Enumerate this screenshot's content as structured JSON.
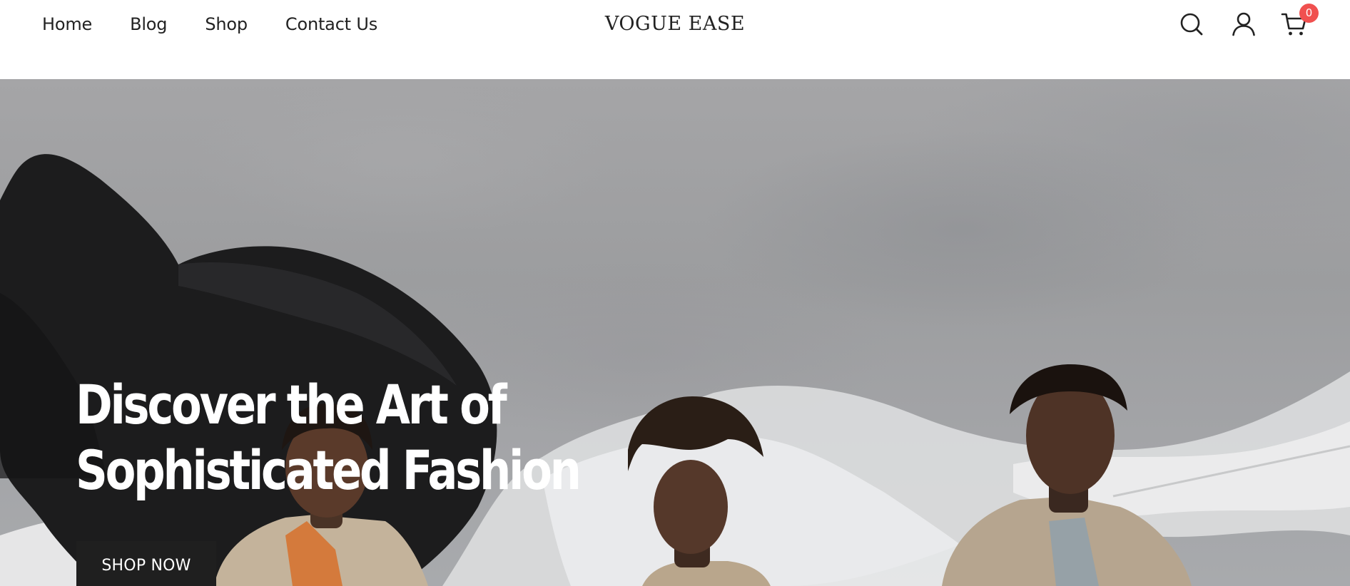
{
  "header": {
    "nav": [
      {
        "label": "Home"
      },
      {
        "label": "Blog"
      },
      {
        "label": "Shop"
      },
      {
        "label": "Contact Us"
      }
    ],
    "logo": "VOGUE EASE",
    "icons": {
      "search": "search-icon",
      "account": "user-icon",
      "cart": "cart-icon"
    },
    "cart_count": "0",
    "badge_color": "#f0504f"
  },
  "hero": {
    "title": "Discover the Art of Sophisticated Fashion",
    "cta_label": "SHOP NOW",
    "cta_color": "#1f1f1f"
  }
}
